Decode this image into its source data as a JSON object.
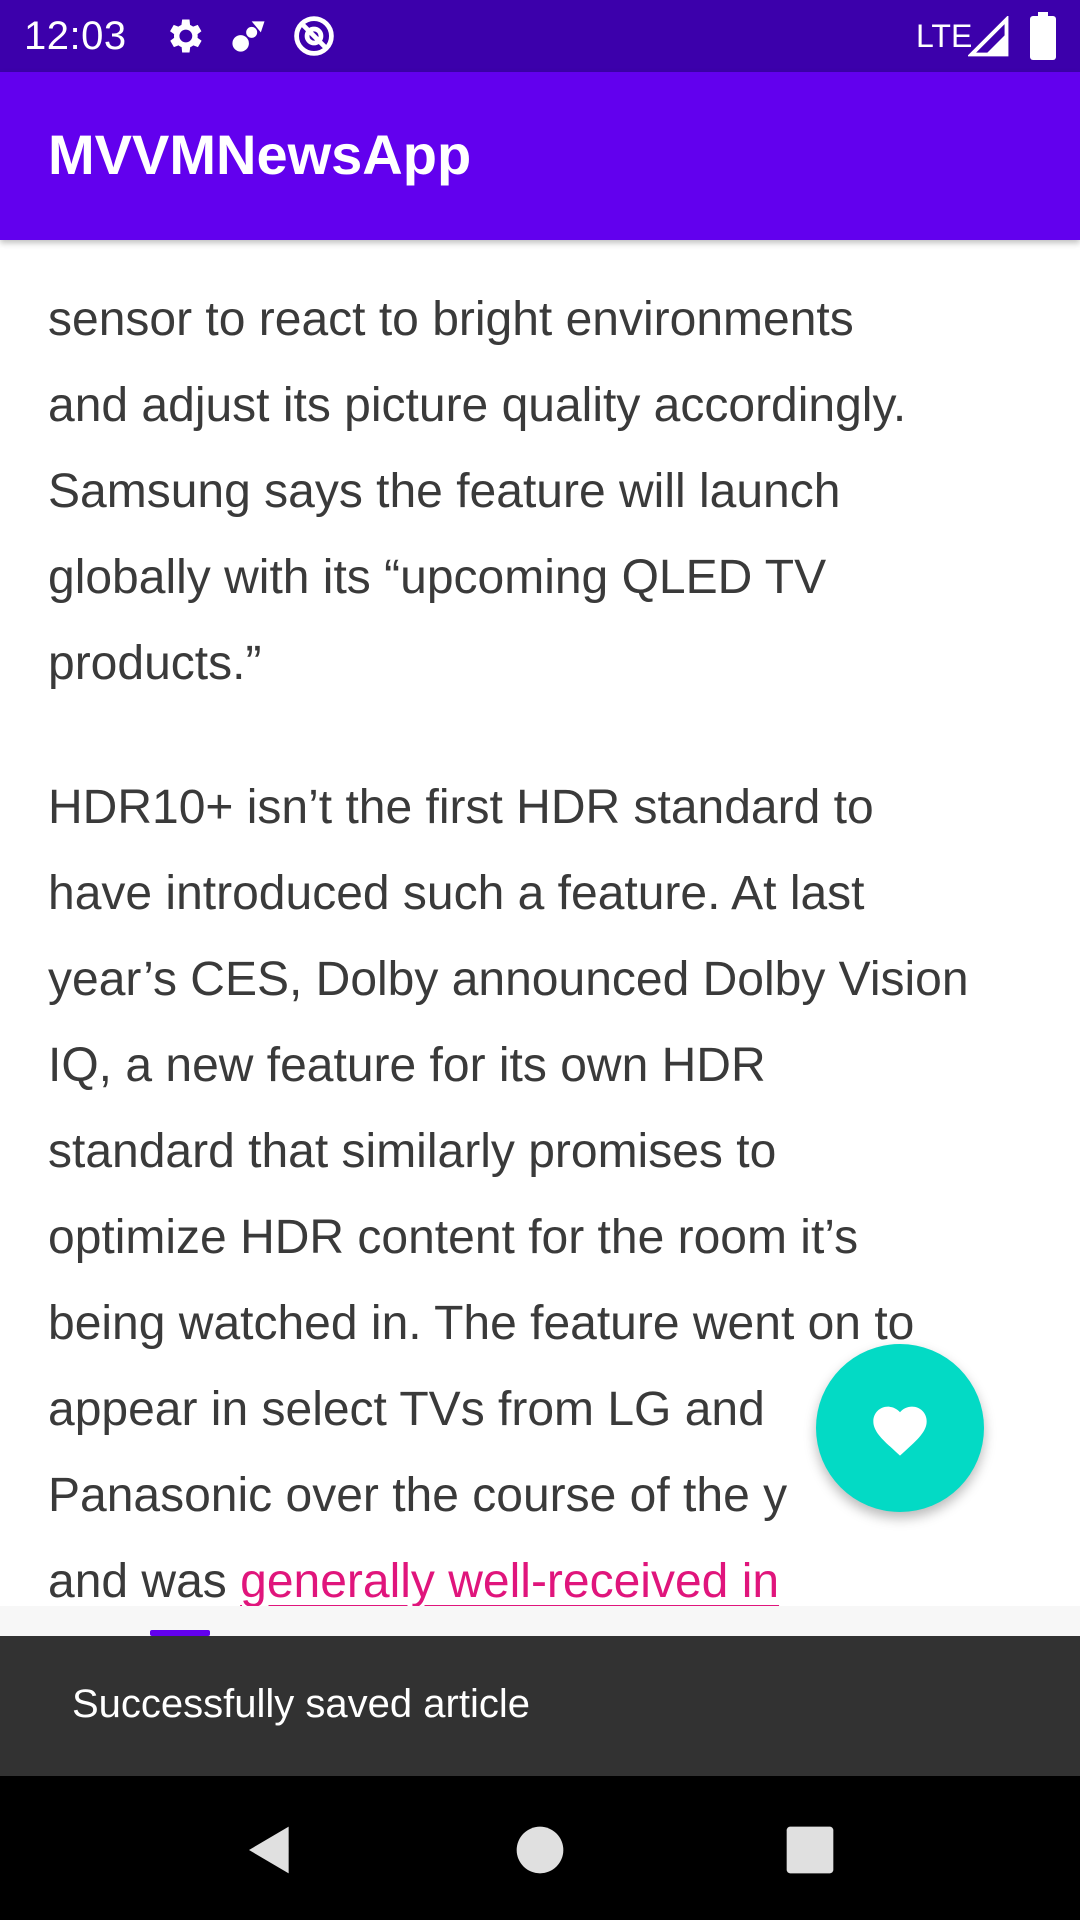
{
  "status_bar": {
    "time": "12:03",
    "network": "LTE",
    "icons": [
      "gear-icon",
      "cloud-sync-icon",
      "at-sign-icon",
      "signal-icon",
      "battery-icon"
    ],
    "background": "#3c00ab"
  },
  "app_bar": {
    "title": "MVVMNewsApp",
    "background": "#6200ee"
  },
  "article": {
    "paragraph1_lines": [
      "sensor to react to bright environments",
      "and adjust its picture quality accordingly.",
      "Samsung says the feature will launch",
      "globally with its “upcoming QLED TV",
      "products.”"
    ],
    "paragraph2_lines": [
      "HDR10+ isn’t the first HDR standard to",
      "have introduced such a feature. At last",
      "year’s CES, Dolby announced Dolby Vision",
      "IQ, a new feature for its own HDR",
      "standard that similarly promises to",
      "optimize HDR content for the room it’s",
      "being watched in. The feature went on to",
      "appear in select TVs from LG and",
      "Panasonic over the course of the y"
    ],
    "last_line_prefix": "and was ",
    "last_line_link": "generally well-received in",
    "link_color": "#e0157c"
  },
  "fab": {
    "icon": "heart-icon",
    "color": "#03dac5"
  },
  "snackbar": {
    "message": "Successfully saved article"
  },
  "nav_bar": {
    "back": "back-icon",
    "home": "home-icon",
    "recents": "recents-icon"
  }
}
